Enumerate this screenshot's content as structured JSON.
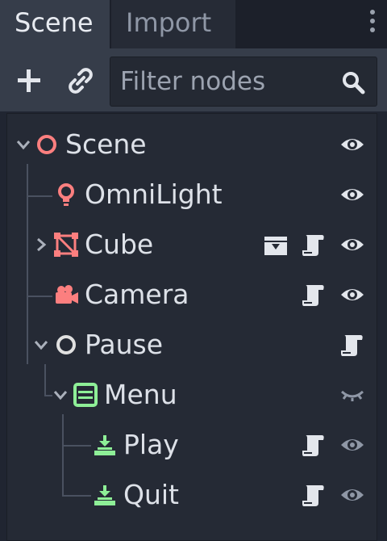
{
  "tabs": [
    {
      "label": "Scene",
      "active": true
    },
    {
      "label": "Import",
      "active": false
    }
  ],
  "toolbar": {
    "add_icon": "plus-icon",
    "link_icon": "link-icon",
    "filter_placeholder": "Filter nodes",
    "filter_value": "",
    "search_icon": "search-icon"
  },
  "tree": {
    "nodes": [
      {
        "label": "Scene",
        "type": "Spatial",
        "depth": 0,
        "expanded": true,
        "visible": true,
        "script": false,
        "instance": false
      },
      {
        "label": "OmniLight",
        "type": "OmniLight",
        "depth": 1,
        "visible": true,
        "script": false
      },
      {
        "label": "Cube",
        "type": "MeshInstance",
        "depth": 1,
        "expanded": false,
        "visible": true,
        "script": true,
        "instance": true
      },
      {
        "label": "Camera",
        "type": "Camera",
        "depth": 1,
        "visible": true,
        "script": true
      },
      {
        "label": "Pause",
        "type": "Node",
        "depth": 1,
        "expanded": true,
        "script": true
      },
      {
        "label": "Menu",
        "type": "VBoxContainer",
        "depth": 2,
        "expanded": true,
        "visible": false
      },
      {
        "label": "Play",
        "type": "Button",
        "depth": 3,
        "visible": true,
        "dimmed_eye": true,
        "script": true
      },
      {
        "label": "Quit",
        "type": "Button",
        "depth": 3,
        "visible": true,
        "dimmed_eye": true,
        "script": true
      }
    ]
  },
  "colors": {
    "spatial_node": "#fc7f7f",
    "control_node": "#8eef97",
    "plain_node": "#e0e0e0",
    "background": "#202531",
    "panel": "#363d4a"
  }
}
